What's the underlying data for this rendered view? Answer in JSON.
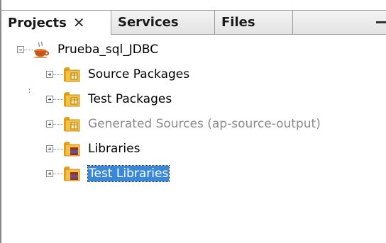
{
  "tabs": [
    {
      "label": "Projects",
      "active": true,
      "close": "✕"
    },
    {
      "label": "Services",
      "active": false
    },
    {
      "label": "Files",
      "active": false
    }
  ],
  "project": {
    "name": "Prueba_sql_JDBC",
    "icon": "coffee-cup-icon",
    "expanded": true
  },
  "nodes": [
    {
      "label": "Source Packages",
      "icon": "package-folder-icon",
      "disabled": false,
      "selected": false
    },
    {
      "label": "Test Packages",
      "icon": "package-folder-icon",
      "disabled": false,
      "selected": false
    },
    {
      "label": "Generated Sources (ap-source-output)",
      "icon": "package-folder-icon",
      "disabled": true,
      "selected": false
    },
    {
      "label": "Libraries",
      "icon": "library-folder-icon",
      "disabled": false,
      "selected": false
    },
    {
      "label": "Test Libraries",
      "icon": "library-folder-icon",
      "disabled": false,
      "selected": true
    }
  ],
  "colors": {
    "selection": "#3a88d8",
    "disabled_text": "#8a8a8a",
    "folder": "#f0b02a"
  }
}
